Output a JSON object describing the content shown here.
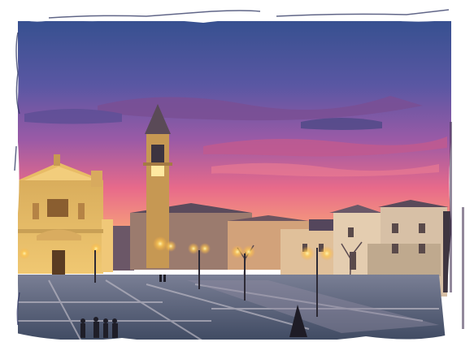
{
  "photo": {
    "subject": "town-square-at-dusk",
    "border_style": "white-brush-stroke-frame",
    "colors": {
      "frame": "#ffffff",
      "sky_top": "#3a4f8e",
      "sky_mid": "#7a4fa0",
      "sky_glow": "#f06a80",
      "horizon": "#f7b07a",
      "church_facade": "#e0b665",
      "tower": "#c99a55",
      "buildings": "#d8b07e",
      "pavement": "#5d6a84",
      "lamp_light": "#ffd36a"
    }
  }
}
